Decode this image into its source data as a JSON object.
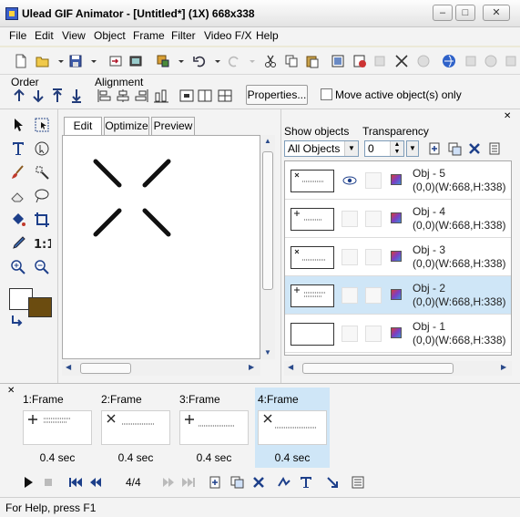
{
  "window": {
    "title": "Ulead GIF Animator - [Untitled*] (1X) 668x338",
    "minimize": "–",
    "maximize": "□",
    "close": "✕"
  },
  "menu": [
    "File",
    "Edit",
    "View",
    "Object",
    "Frame",
    "Filter",
    "Video F/X",
    "Help"
  ],
  "orderbar": {
    "order_label": "Order",
    "alignment_label": "Alignment",
    "properties_button": "Properties...",
    "move_active_label": "Move active object(s) only"
  },
  "canvas_tabs": [
    "Edit",
    "Optimize",
    "Preview"
  ],
  "object_manager": {
    "show_objects_label": "Show objects",
    "show_objects_value": "All Objects",
    "transparency_label": "Transparency",
    "transparency_value": "0",
    "close_glyph": "✕",
    "objects": [
      {
        "name": "Obj - 5",
        "info": "(0,0)(W:668,H:338)",
        "visible": true,
        "selected": false
      },
      {
        "name": "Obj - 4",
        "info": "(0,0)(W:668,H:338)",
        "visible": false,
        "selected": false
      },
      {
        "name": "Obj - 3",
        "info": "(0,0)(W:668,H:338)",
        "visible": false,
        "selected": false
      },
      {
        "name": "Obj - 2",
        "info": "(0,0)(W:668,H:338)",
        "visible": false,
        "selected": true
      },
      {
        "name": "Obj - 1",
        "info": "(0,0)(W:668,H:338)",
        "visible": false,
        "selected": false
      }
    ]
  },
  "frames": [
    {
      "label": "1:Frame",
      "delay": "0.4 sec",
      "mark": "+",
      "selected": false
    },
    {
      "label": "2:Frame",
      "delay": "0.4 sec",
      "mark": "×",
      "selected": false
    },
    {
      "label": "3:Frame",
      "delay": "0.4 sec",
      "mark": "+",
      "selected": false
    },
    {
      "label": "4:Frame",
      "delay": "0.4 sec",
      "mark": "×",
      "selected": true
    }
  ],
  "frame_panel_close": "✕",
  "playbar": {
    "frame_counter": "4/4"
  },
  "status": {
    "text": "For Help, press F1"
  },
  "colors": {
    "foreground": "#ffffff",
    "background": "#6b4c10",
    "selection": "#cfe6f7"
  }
}
